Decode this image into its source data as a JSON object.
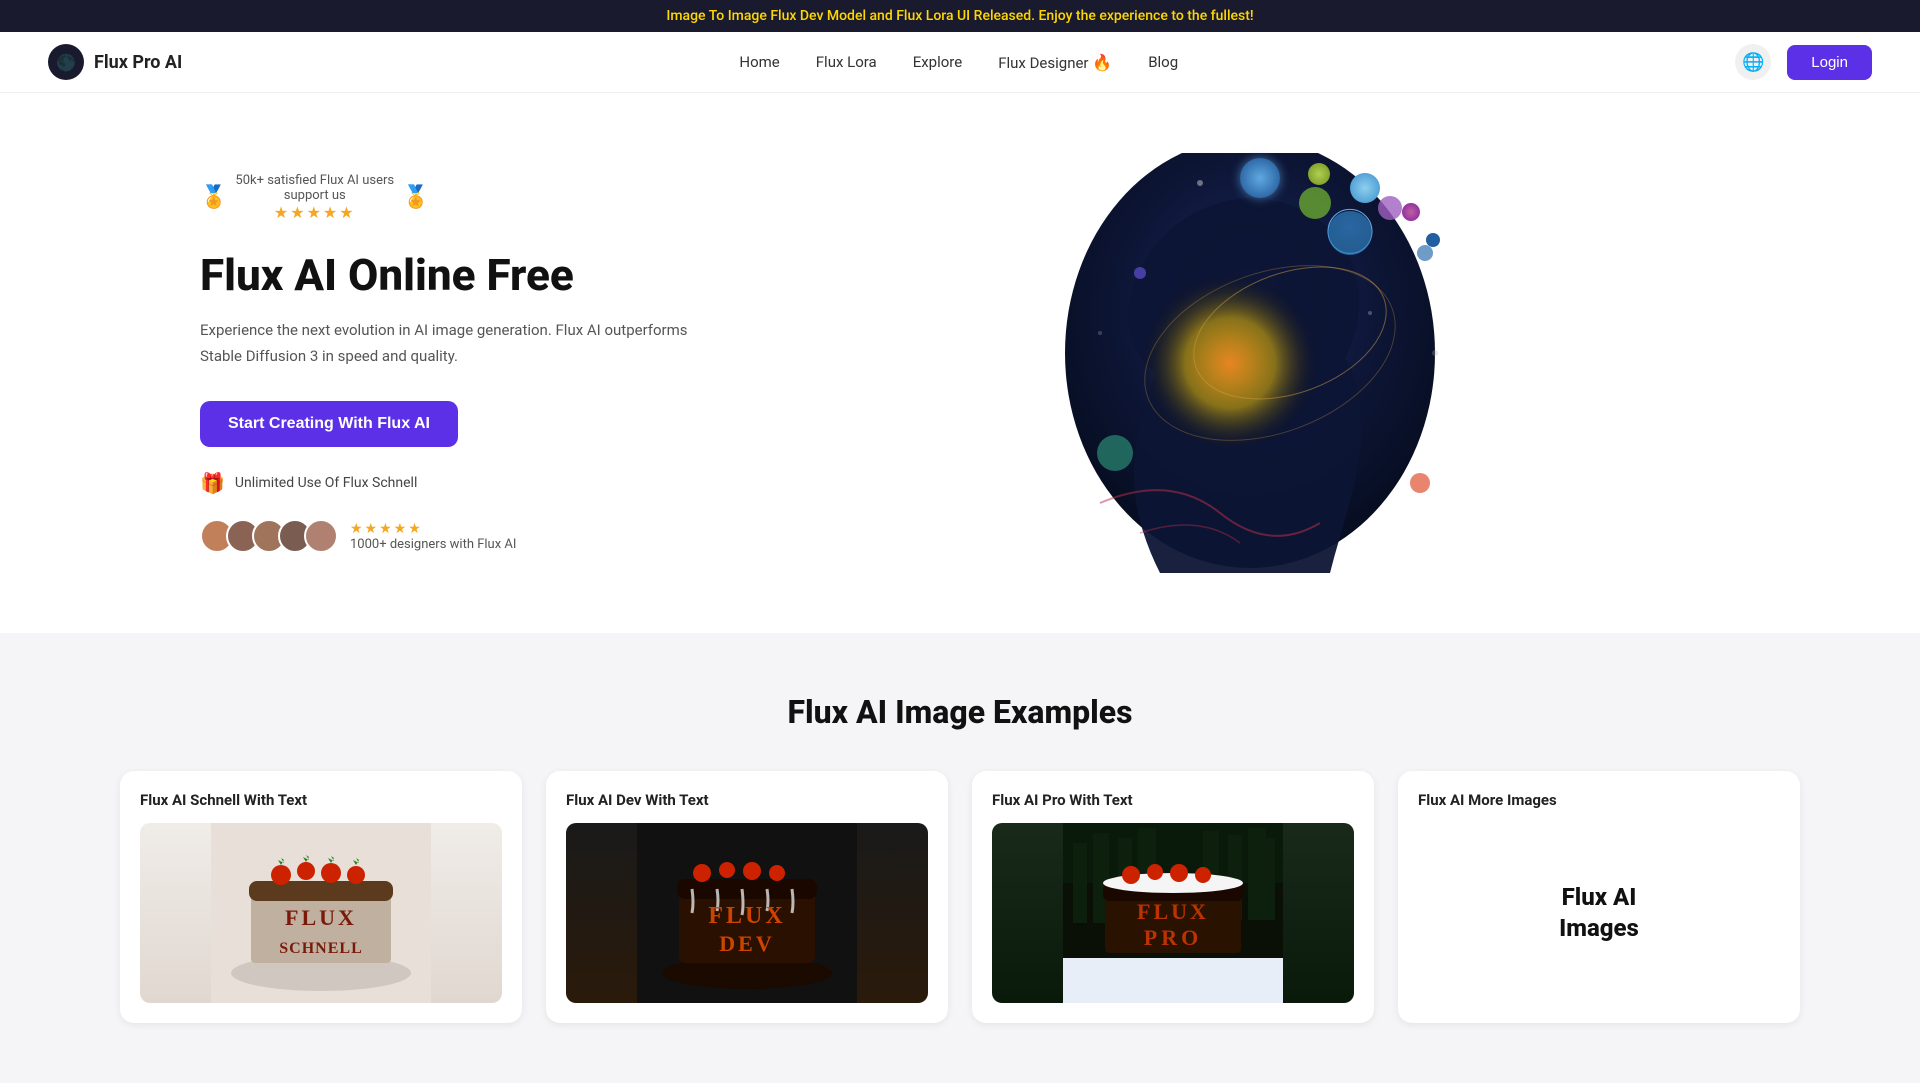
{
  "banner": {
    "text": "Image To Image Flux Dev Model and Flux Lora UI Released. Enjoy the experience to the fullest!"
  },
  "header": {
    "logo_text": "Flux Pro AI",
    "logo_icon": "🌐",
    "nav": [
      {
        "label": "Home",
        "id": "home"
      },
      {
        "label": "Flux Lora",
        "id": "flux-lora"
      },
      {
        "label": "Explore",
        "id": "explore"
      },
      {
        "label": "Flux Designer",
        "id": "flux-designer",
        "flame": "🔥"
      },
      {
        "label": "Blog",
        "id": "blog"
      }
    ],
    "login_label": "Login"
  },
  "hero": {
    "social_proof": {
      "text_line1": "50k+ satisfied Flux AI users",
      "text_line2": "support us",
      "stars": "★★★★★"
    },
    "title": "Flux AI Online Free",
    "description": "Experience the next evolution in AI image generation. Flux AI outperforms Stable Diffusion 3 in speed and quality.",
    "cta_label": "Start Creating With Flux AI",
    "unlimited_label": "Unlimited Use Of Flux Schnell",
    "designer_stars": "★★★★★",
    "designer_count": "1000+ designers with Flux AI"
  },
  "examples": {
    "section_title": "Flux AI Image Examples",
    "cards": [
      {
        "title": "Flux AI Schnell With Text",
        "type": "cake-schnell",
        "cake_text": "FLUX\nSCHNELL"
      },
      {
        "title": "Flux AI Dev With Text",
        "type": "cake-dev",
        "cake_text": "FLUX\nDEV"
      },
      {
        "title": "Flux AI Pro With Text",
        "type": "cake-pro",
        "cake_text": "FLUX\nPRO"
      },
      {
        "title": "Flux AI More Images",
        "type": "more-images",
        "more_text_line1": "Flux AI",
        "more_text_line2": "Images"
      }
    ]
  }
}
